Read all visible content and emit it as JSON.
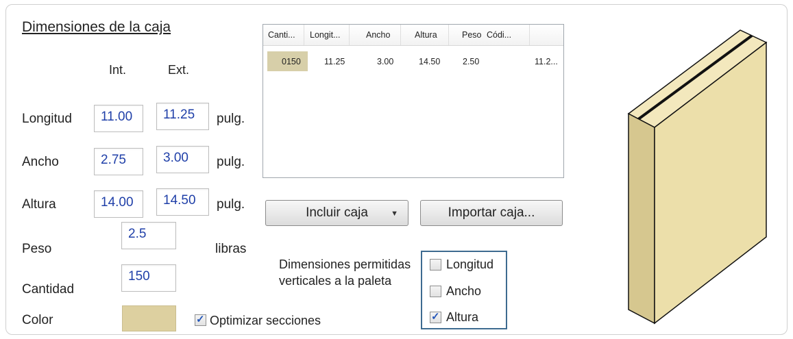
{
  "section_title": "Dimensiones de la caja",
  "headers": {
    "int": "Int.",
    "ext": "Ext."
  },
  "rows": {
    "longitud": {
      "label": "Longitud",
      "int": "11.00",
      "ext": "11.25",
      "unit": "pulg."
    },
    "ancho": {
      "label": "Ancho",
      "int": "2.75",
      "ext": "3.00",
      "unit": "pulg."
    },
    "altura": {
      "label": "Altura",
      "int": "14.00",
      "ext": "14.50",
      "unit": "pulg."
    },
    "peso": {
      "label": "Peso",
      "value": "2.5",
      "unit": "libras"
    },
    "cantidad": {
      "label": "Cantidad",
      "value": "150"
    },
    "color": {
      "label": "Color",
      "value": "#ddd0a0"
    }
  },
  "optimize": {
    "label": "Optimizar secciones",
    "checked": true
  },
  "table": {
    "columns": [
      "Canti...",
      "Longit...",
      "Ancho",
      "Altura",
      "Peso",
      "Códi..."
    ],
    "row": [
      "0150",
      "11.25",
      "3.00",
      "14.50",
      "2.50",
      "",
      "11.2..."
    ]
  },
  "buttons": {
    "include": "Incluir caja",
    "import": "Importar caja..."
  },
  "permitted": {
    "label_line1": "Dimensiones permitidas",
    "label_line2": "verticales a la paleta",
    "options": [
      {
        "label": "Longitud",
        "checked": false
      },
      {
        "label": "Ancho",
        "checked": false
      },
      {
        "label": "Altura",
        "checked": true
      }
    ]
  },
  "colors": {
    "box_face": "#ecdfaa",
    "box_side": "#d6c78f",
    "box_top": "#f3e8bd",
    "accent": "#3d6b90"
  }
}
